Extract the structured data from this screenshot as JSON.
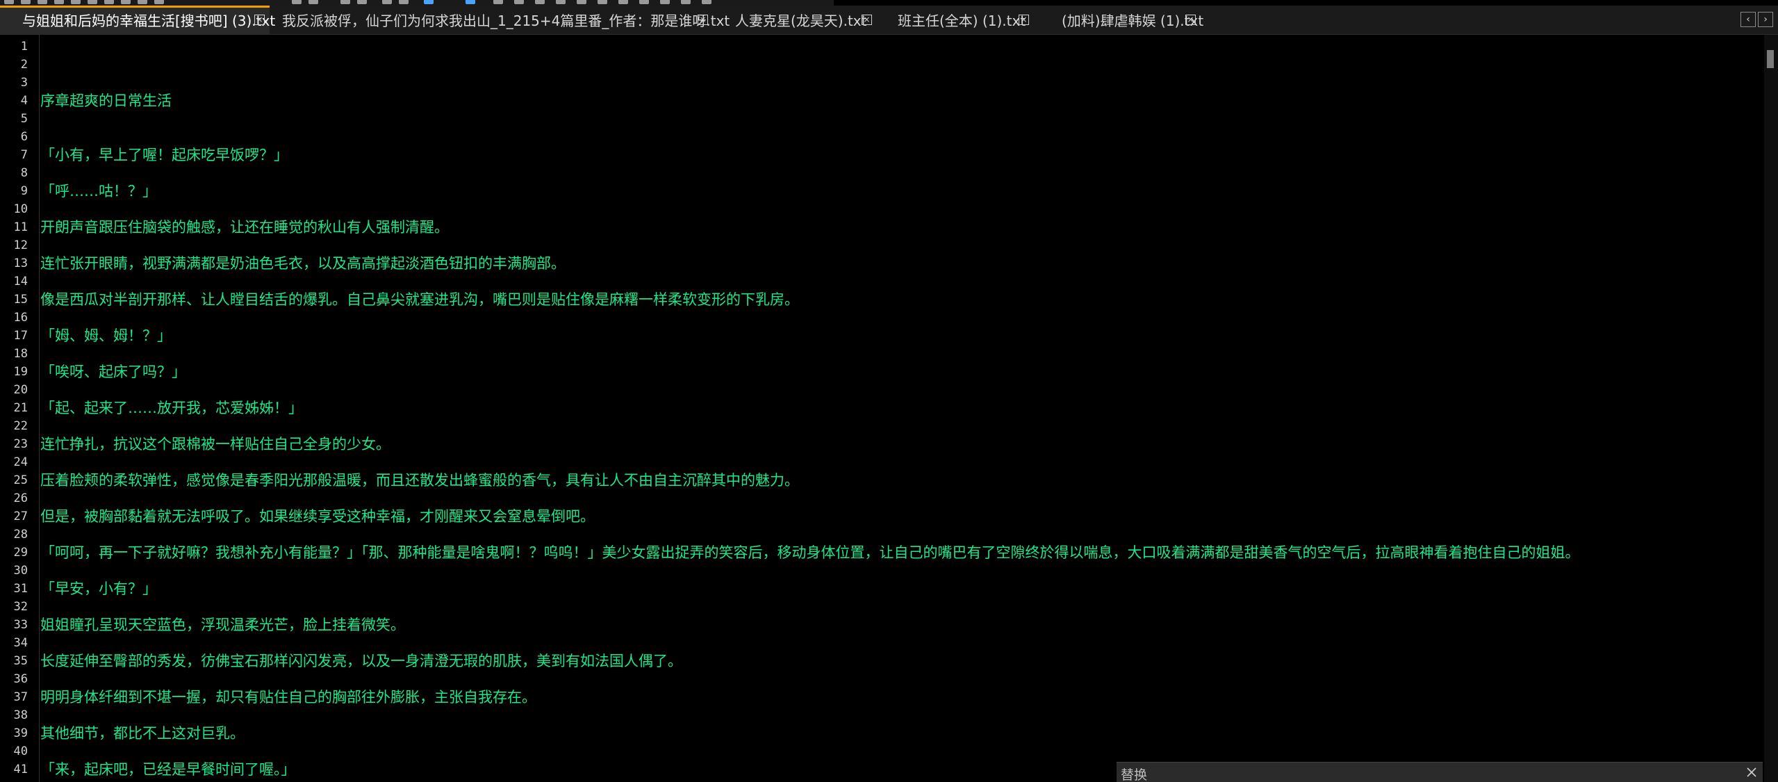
{
  "tabs": [
    {
      "label": "与姐姐和后妈的幸福生活[搜书吧] (3).txt",
      "active": true,
      "modified": false
    },
    {
      "label": "我反派被俘，仙子们为何求我出山_1_215+4篇里番_作者：那是谁呀.txt",
      "active": false,
      "modified": true
    },
    {
      "label": "人妻克星(龙昊天).txt",
      "active": false,
      "modified": false
    },
    {
      "label": "班主任(全本) (1).txt",
      "active": false,
      "modified": false
    },
    {
      "label": "(加料)肆虐韩娱 (1).txt",
      "active": false,
      "modified": false
    }
  ],
  "tab_nav": {
    "prev": "‹",
    "next": "›"
  },
  "close_glyph": "×",
  "line_numbers": [
    "1",
    "2",
    "3",
    "4",
    "5",
    "6",
    "7",
    "8",
    "9",
    "10",
    "11",
    "12",
    "13",
    "14",
    "15",
    "16",
    "17",
    "18",
    "19",
    "20",
    "21",
    "22",
    "23",
    "24",
    "25",
    "26",
    "27",
    "28",
    "29",
    "30",
    "31",
    "32",
    "33",
    "34",
    "35",
    "36",
    "37",
    "38",
    "39",
    "40",
    "41"
  ],
  "lines": [
    "",
    "",
    "",
    "序章超爽的日常生活",
    "",
    "",
    "「小有，早上了喔！起床吃早饭啰？」",
    "",
    "「呼……咕！？」",
    "",
    "开朗声音跟压住脑袋的触感，让还在睡觉的秋山有人强制清醒。",
    "",
    "连忙张开眼睛，视野满满都是奶油色毛衣，以及高高撑起淡酒色钮扣的丰满胸部。",
    "",
    "像是西瓜对半剖开那样、让人瞠目结舌的爆乳。自己鼻尖就塞进乳沟，嘴巴则是贴住像是麻糬一样柔软变形的下乳房。",
    "",
    "「姆、姆、姆！？」",
    "",
    "「唉呀、起床了吗？」",
    "",
    "「起、起来了……放开我，芯爱姊姊！」",
    "",
    "连忙挣扎，抗议这个跟棉被一样贴住自己全身的少女。",
    "",
    "压着脸颊的柔软弹性，感觉像是春季阳光那般温暖，而且还散发出蜂蜜般的香气，具有让人不由自主沉醉其中的魅力。",
    "",
    "但是，被胸部黏着就无法呼吸了。如果继续享受这种幸福，才刚醒来又会窒息晕倒吧。",
    "",
    "「呵呵，再一下子就好嘛？我想补充小有能量？」「那、那种能量是啥鬼啊！？呜呜！」美少女露出捉弄的笑容后，移动身体位置，让自己的嘴巴有了空隙终於得以喘息，大口吸着满满都是甜美香气的空气后，拉高眼神看着抱住自己的姐姐。",
    "",
    "「早安，小有？」",
    "",
    "姐姐瞳孔呈现天空蓝色，浮现温柔光芒，脸上挂着微笑。",
    "",
    "长度延伸至臀部的秀发，彷佛宝石那样闪闪发亮，以及一身清澄无瑕的肌肤，美到有如法国人偶了。",
    "",
    "明明身体纤细到不堪一握，却只有贴住自己的胸部往外膨胀，主张自我存在。",
    "",
    "其他细节，都比不上这对巨乳。",
    "",
    "「来，起床吧，已经是早餐时间了喔。」"
  ],
  "replace_panel": {
    "title": "替换"
  },
  "colors": {
    "text": "#1fe68a",
    "background": "#000000",
    "active_tab_accent": "#f0a000"
  }
}
